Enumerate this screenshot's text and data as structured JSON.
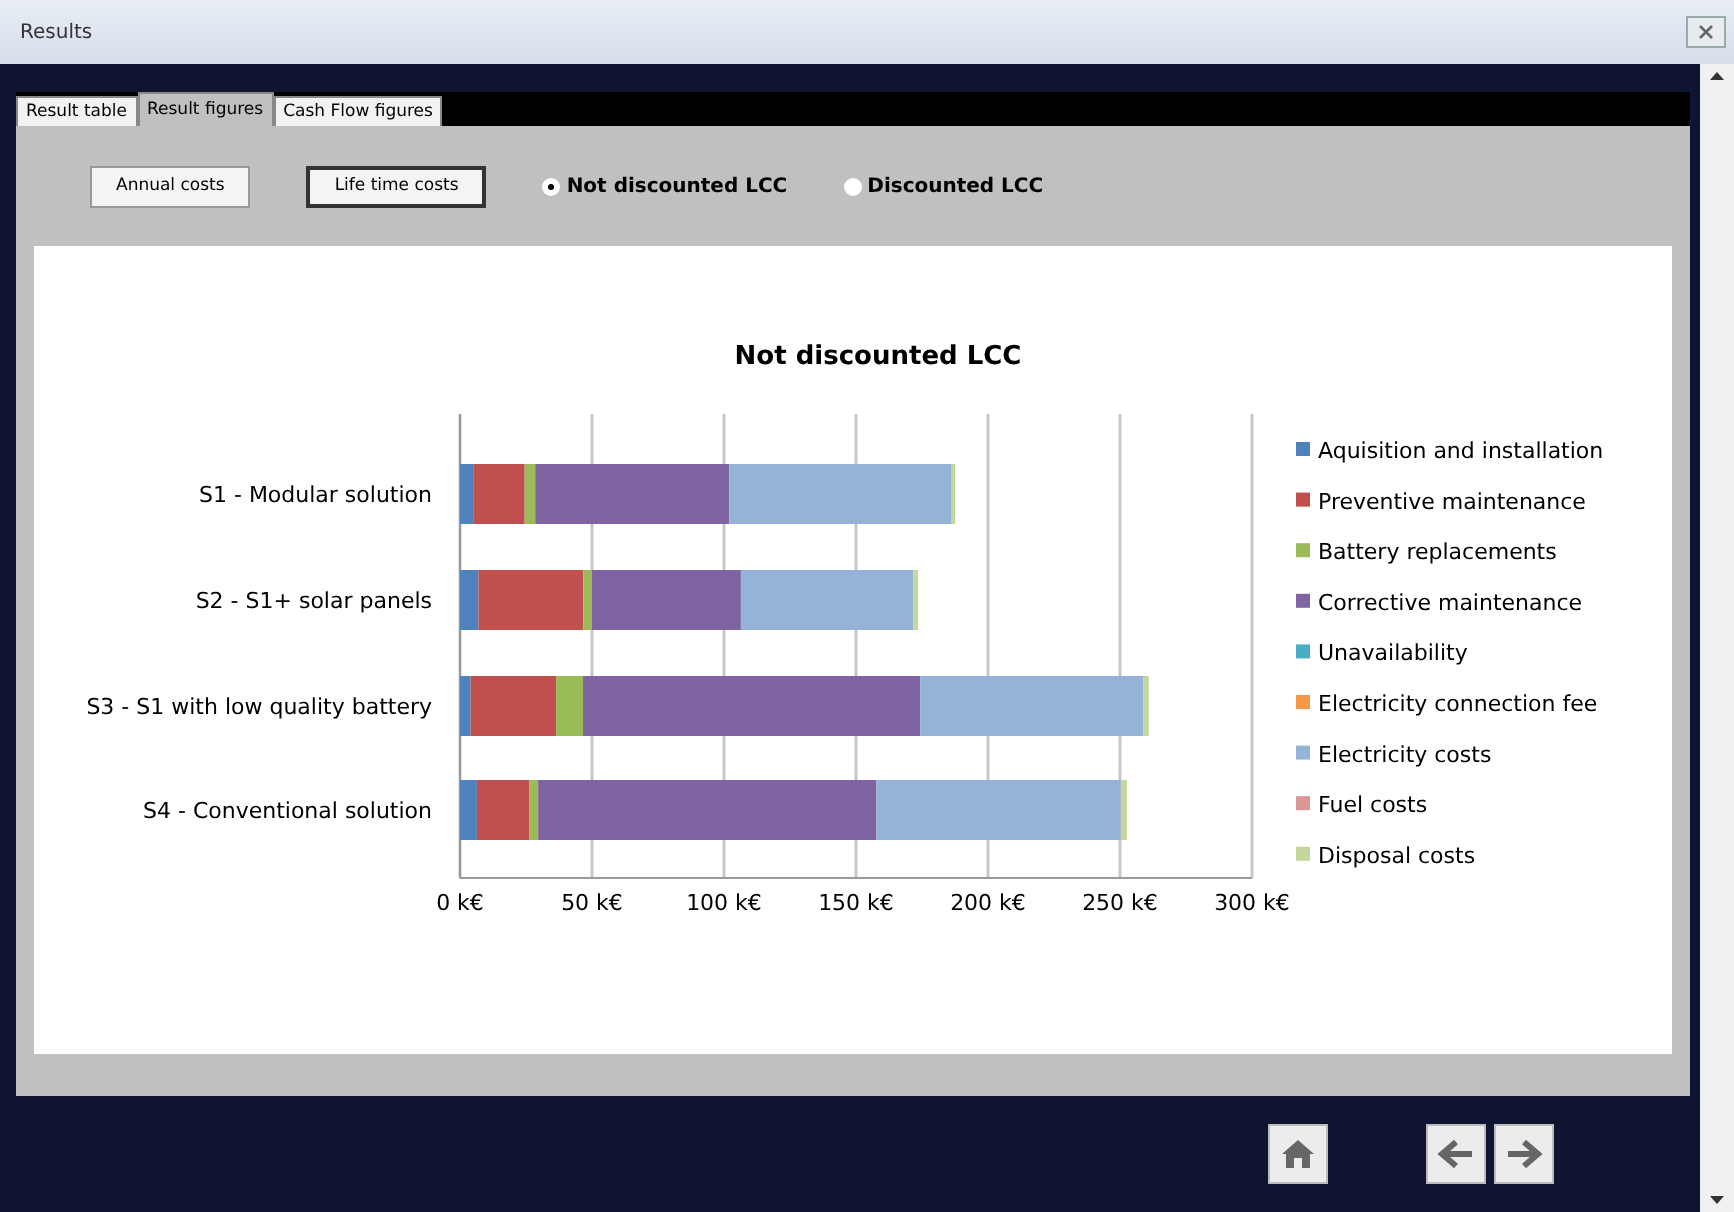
{
  "window": {
    "title": "Results"
  },
  "tabs": [
    {
      "label": "Result table",
      "selected": false
    },
    {
      "label": "Result figures",
      "selected": true
    },
    {
      "label": "Cash Flow figures",
      "selected": false
    }
  ],
  "view_buttons": [
    {
      "label": "Annual costs",
      "selected": false
    },
    {
      "label": "Life time costs",
      "selected": true
    }
  ],
  "radios": [
    {
      "label": "Not discounted LCC",
      "selected": true
    },
    {
      "label": "Discounted LCC",
      "selected": false
    }
  ],
  "chart": {
    "chart_data": {
      "type": "bar",
      "orientation": "horizontal",
      "stacked": true,
      "grid": true,
      "legend": "right",
      "title": "Not discounted LCC",
      "categories": [
        "S1 - Modular solution",
        "S2 - S1+ solar panels",
        "S3 - S1 with low quality battery",
        "S4 - Conventional solution"
      ],
      "xlim": [
        0,
        300
      ],
      "xticks": [
        {
          "value": 0,
          "label": "0 k€"
        },
        {
          "value": 50,
          "label": "50 k€"
        },
        {
          "value": 100,
          "label": "100 k€"
        },
        {
          "value": 150,
          "label": "150 k€"
        },
        {
          "value": 200,
          "label": "200 k€"
        },
        {
          "value": 250,
          "label": "250 k€"
        },
        {
          "value": 300,
          "label": "300 k€"
        }
      ],
      "series": [
        {
          "name": "Aquisition and installation",
          "color": "#4f81bd",
          "values": [
            5,
            7,
            4,
            6.4
          ]
        },
        {
          "name": "Preventive maintenance",
          "color": "#c0504d",
          "values": [
            19.5,
            39.7,
            32.4,
            19.9
          ]
        },
        {
          "name": "Battery replacements",
          "color": "#9bbb59",
          "values": [
            4,
            3.3,
            10.2,
            3.3
          ]
        },
        {
          "name": "Corrective maintenance",
          "color": "#8064a2",
          "values": [
            73.5,
            56.4,
            127.8,
            128.1
          ]
        },
        {
          "name": "Unavailability",
          "color": "#4bacc6",
          "values": [
            0,
            0,
            0,
            0
          ]
        },
        {
          "name": "Electricity connection fee",
          "color": "#f79646",
          "values": [
            0,
            0,
            0,
            0
          ]
        },
        {
          "name": "Electricity costs",
          "color": "#95b3d7",
          "values": [
            84,
            65.3,
            84.5,
            92.6
          ]
        },
        {
          "name": "Fuel costs",
          "color": "#d99694",
          "values": [
            0,
            0,
            0,
            0
          ]
        },
        {
          "name": "Disposal costs",
          "color": "#c3d69b",
          "values": [
            1.5,
            1.8,
            2,
            2.3
          ]
        }
      ]
    }
  }
}
